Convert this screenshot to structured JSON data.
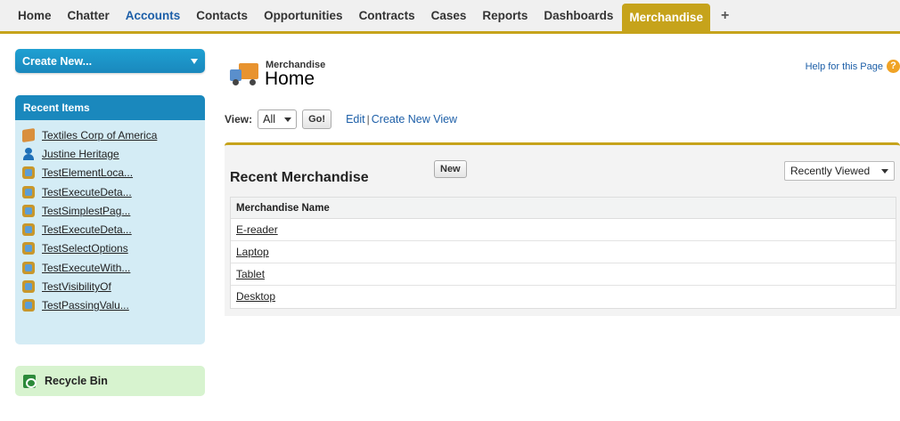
{
  "tabs": [
    {
      "label": "Home",
      "style": "normal"
    },
    {
      "label": "Chatter",
      "style": "normal"
    },
    {
      "label": "Accounts",
      "style": "blue"
    },
    {
      "label": "Contacts",
      "style": "normal"
    },
    {
      "label": "Opportunities",
      "style": "normal"
    },
    {
      "label": "Contracts",
      "style": "normal"
    },
    {
      "label": "Cases",
      "style": "normal"
    },
    {
      "label": "Reports",
      "style": "normal"
    },
    {
      "label": "Dashboards",
      "style": "normal"
    },
    {
      "label": "Merchandise",
      "style": "active"
    },
    {
      "label": "+",
      "style": "plus"
    }
  ],
  "sidebar": {
    "create_new": "Create New...",
    "recent_title": "Recent Items",
    "recent_items": [
      {
        "label": "Textiles Corp of America",
        "icon": "account-icon"
      },
      {
        "label": "Justine Heritage",
        "icon": "contact-icon"
      },
      {
        "label": "TestElementLoca...",
        "icon": "merchandise-icon"
      },
      {
        "label": "TestExecuteDeta...",
        "icon": "merchandise-icon"
      },
      {
        "label": "TestSimplestPag...",
        "icon": "merchandise-icon"
      },
      {
        "label": "TestExecuteDeta...",
        "icon": "merchandise-icon"
      },
      {
        "label": "TestSelectOptions",
        "icon": "merchandise-icon"
      },
      {
        "label": "TestExecuteWith...",
        "icon": "merchandise-icon"
      },
      {
        "label": "TestVisibilityOf",
        "icon": "merchandise-icon"
      },
      {
        "label": "TestPassingValu...",
        "icon": "merchandise-icon"
      }
    ],
    "recycle_bin": "Recycle Bin"
  },
  "header": {
    "object_label": "Merchandise",
    "title": "Home",
    "help_link": "Help for this Page",
    "help_icon": "?"
  },
  "view": {
    "label": "View:",
    "selected": "All",
    "go_button": "Go!",
    "edit_link": "Edit",
    "separator": "|",
    "create_view_link": "Create New View"
  },
  "recent_panel": {
    "title": "Recent Merchandise",
    "new_button": "New",
    "filter_selected": "Recently Viewed",
    "column_header": "Merchandise Name",
    "rows": [
      "E-reader",
      "Laptop",
      "Tablet",
      "Desktop"
    ]
  },
  "colors": {
    "accent_gold": "#c6a31b",
    "link_blue": "#1d5fa8",
    "sidebar_blue": "#1a88bd",
    "sidebar_bg": "#d4ecf5",
    "recycle_bg": "#d7f3cf"
  }
}
